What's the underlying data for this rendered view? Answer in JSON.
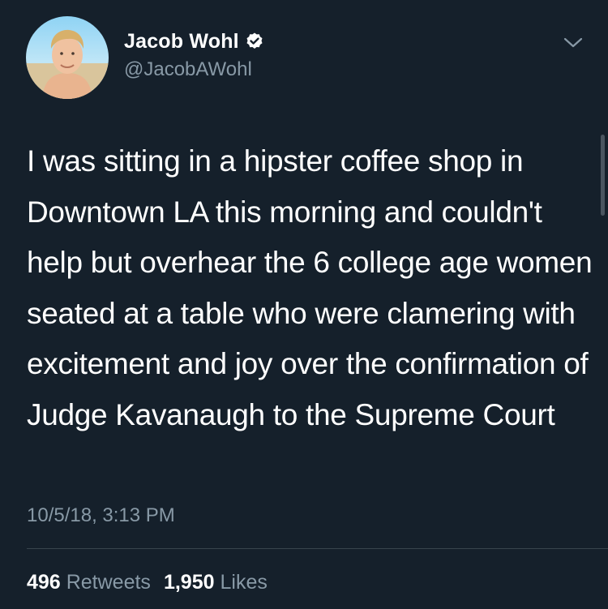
{
  "tweet": {
    "author": {
      "display_name": "Jacob Wohl",
      "handle": "@JacobAWohl",
      "verified": true,
      "avatar_icon": "profile-photo"
    },
    "text": "I was sitting in a hipster coffee shop in Downtown LA this morning and couldn't help but overhear the 6 college age women seated at a table who were clamering with excitement and joy over the confirmation of Judge Kavanaugh to the Supreme Court",
    "timestamp": "10/5/18, 3:13 PM",
    "stats": {
      "retweets_count": "496",
      "retweets_label": "Retweets",
      "likes_count": "1,950",
      "likes_label": "Likes"
    },
    "menu_icon": "chevron-down-icon"
  },
  "colors": {
    "background": "#15202b",
    "primary_text": "#ffffff",
    "secondary_text": "#8899a6",
    "divider": "#38444d",
    "verified_badge": "#ffffff"
  }
}
